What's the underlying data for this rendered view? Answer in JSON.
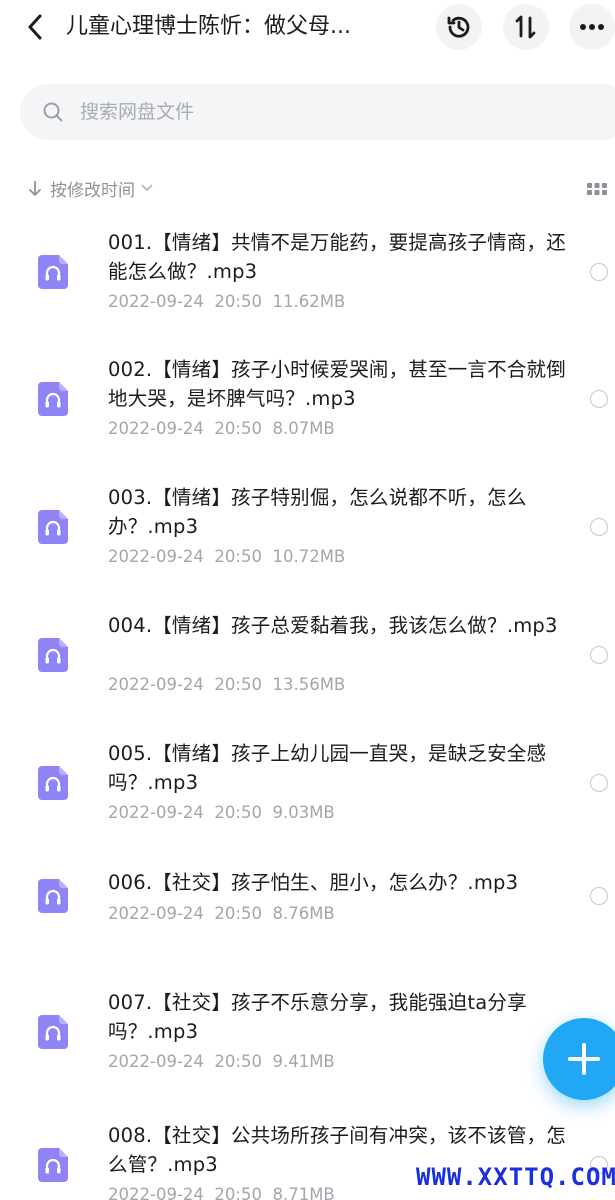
{
  "header": {
    "title": "儿童心理博士陈忻：做父母...",
    "icons": {
      "back": "chevron-left-icon",
      "history": "history-icon",
      "sort": "sort-icon",
      "more": "more-icon"
    }
  },
  "search": {
    "placeholder": "搜索网盘文件"
  },
  "sortbar": {
    "label": "按修改时间"
  },
  "files": [
    {
      "name": "001.【情绪】共情不是万能药，要提高孩子情商，还能怎么做？.mp3",
      "date": "2022-09-24",
      "time": "20:50",
      "size": "11.62MB"
    },
    {
      "name": "002.【情绪】孩子小时候爱哭闹，甚至一言不合就倒地大哭，是坏脾气吗？.mp3",
      "date": "2022-09-24",
      "time": "20:50",
      "size": "8.07MB"
    },
    {
      "name": "003.【情绪】孩子特别倔，怎么说都不听，怎么办？.mp3",
      "date": "2022-09-24",
      "time": "20:50",
      "size": "10.72MB"
    },
    {
      "name": "004.【情绪】孩子总爱黏着我，我该怎么做？.mp3",
      "date": "2022-09-24",
      "time": "20:50",
      "size": "13.56MB"
    },
    {
      "name": "005.【情绪】孩子上幼儿园一直哭，是缺乏安全感吗？.mp3",
      "date": "2022-09-24",
      "time": "20:50",
      "size": "9.03MB"
    },
    {
      "name": "006.【社交】孩子怕生、胆小，怎么办？.mp3",
      "date": "2022-09-24",
      "time": "20:50",
      "size": "8.76MB"
    },
    {
      "name": "007.【社交】孩子不乐意分享，我能强迫ta分享吗？.mp3",
      "date": "2022-09-24",
      "time": "20:50",
      "size": "9.41MB"
    },
    {
      "name": "008.【社交】公共场所孩子间有冲突，该不该管，怎么管？.mp3",
      "date": "2022-09-24",
      "time": "20:50",
      "size": "8.71MB"
    }
  ],
  "fab": {
    "icon": "plus-icon"
  },
  "watermark": "WWW.XXTTQ.COM",
  "colors": {
    "accent": "#21a7f4",
    "audio_icon": "#8e84f5",
    "meta_text": "#a2a6ad"
  }
}
